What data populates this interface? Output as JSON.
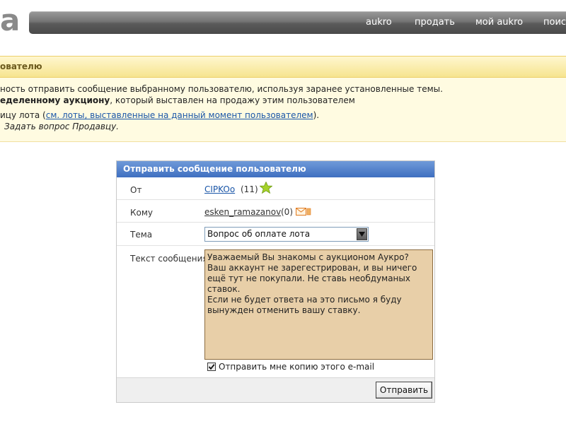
{
  "logo": {
    "text": "a"
  },
  "topnav": {
    "items": [
      "aukro",
      "продать",
      "мой aukro",
      "поис"
    ]
  },
  "info": {
    "title": "ователю",
    "line1": "ность отправить сообщение выбранному пользователю, используя заранее установленные темы.",
    "line2_bold": "еделенному аукциону",
    "line2_rest": ", который выставлен на продажу этим пользователем",
    "line3_pre": "ицу лота (",
    "line3_link": "см. лоты, выставленные на данный момент пользователем",
    "line3_post": ").",
    "line4": "Задать вопрос Продавцу."
  },
  "form": {
    "title": "Отправить сообщение пользователю",
    "from_label": "От",
    "from_user": "CIPKOo",
    "from_rating": "(11)",
    "to_label": "Кому",
    "to_user": "esken_ramazanov",
    "to_rating": "(0)",
    "subject_label": "Тема",
    "subject_value": "Вопрос об оплате лота",
    "message_label": "Текст сообщения",
    "message_text": "Уважаемый Вы знакомы с аукционом Аукро?\nВаш аккаунт не зарегестрирован, и вы ничего ещё тут не покупали. Не ставь необдуманых ставок.\nЕсли не будет ответа на это письмо я буду вынужден отменить вашу ставку.",
    "copy_label": "Отправить мне копию этого e-mail",
    "copy_checked": true,
    "send_label": "Отправить"
  },
  "colors": {
    "form_header": "#4a79c6",
    "message_bg": "#e8cfa8",
    "info_bg": "#fffbe1",
    "link": "#1a56a8"
  }
}
